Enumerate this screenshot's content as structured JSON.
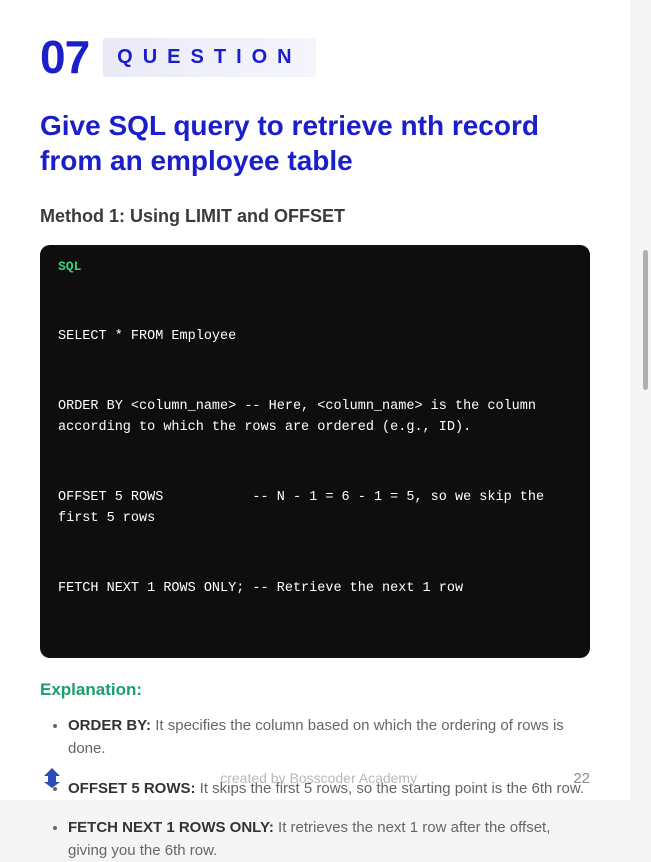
{
  "header": {
    "number": "07",
    "label": "QUESTION"
  },
  "title": "Give SQL query to retrieve nth record from an employee table",
  "method": "Method 1: Using LIMIT and OFFSET",
  "code": {
    "lang": "SQL",
    "lines": [
      "SELECT * FROM Employee",
      "ORDER BY <column_name> -- Here, <column_name> is the column according to which the rows are ordered (e.g., ID).",
      "OFFSET 5 ROWS           -- N - 1 = 6 - 1 = 5, so we skip the first 5 rows",
      "FETCH NEXT 1 ROWS ONLY; -- Retrieve the next 1 row"
    ]
  },
  "explanation": {
    "heading": "Explanation:",
    "items": [
      {
        "term": "ORDER BY:",
        "desc": " It specifies the column based on which the ordering of rows is done."
      },
      {
        "term": "OFFSET 5 ROWS:",
        "desc": " It skips the first 5 rows, so the starting point is the 6th row."
      },
      {
        "term": "FETCH NEXT 1 ROWS ONLY:",
        "desc": " It retrieves the next 1 row after the offset, giving you the 6th row."
      }
    ]
  },
  "footer": {
    "credit": "created by Bosscoder Academy",
    "page": "22"
  }
}
